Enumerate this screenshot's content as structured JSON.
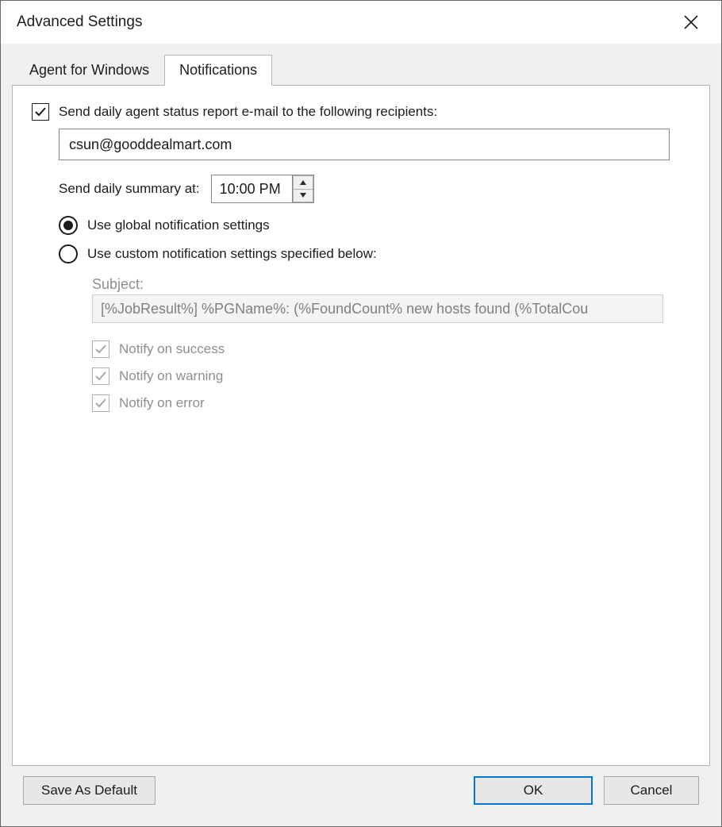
{
  "window": {
    "title": "Advanced Settings"
  },
  "tabs": {
    "agent": "Agent for Windows",
    "notifications": "Notifications"
  },
  "panel": {
    "send_label": "Send daily agent status report e-mail to the following recipients:",
    "recipients_value": "csun@gooddealmart.com",
    "summary_label": "Send daily summary at:",
    "summary_time": "10:00 PM",
    "radio_global": "Use global notification settings",
    "radio_custom": "Use custom notification settings specified below:",
    "subject_label": "Subject:",
    "subject_value": "[%JobResult%] %PGName%: (%FoundCount% new hosts found (%TotalCou",
    "notify_success": "Notify on success",
    "notify_warning": "Notify on warning",
    "notify_error": "Notify on error"
  },
  "footer": {
    "save_default": "Save As Default",
    "ok": "OK",
    "cancel": "Cancel"
  }
}
